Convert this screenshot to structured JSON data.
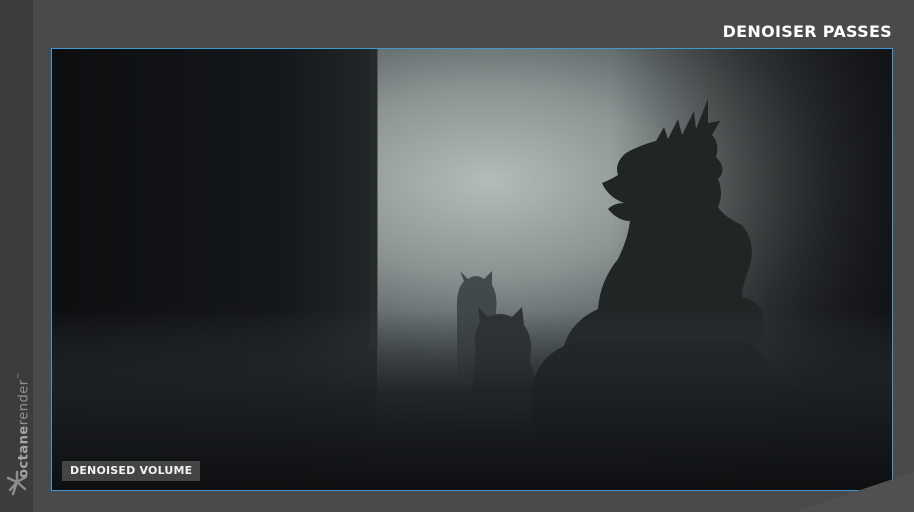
{
  "header": {
    "title": "DENOISER PASSES"
  },
  "sidebar": {
    "brand_bold": "octane",
    "brand_light": "render",
    "brand_tm": "™",
    "logo_icon": "octane-logo-icon"
  },
  "viewport": {
    "pass_label": "DENOISED VOLUME",
    "border_color": "#3f97d4"
  },
  "colors": {
    "background": "#4a4a4a",
    "sidebar": "#3c3c3c",
    "accent": "#3f97d4",
    "title_text": "#ffffff"
  }
}
